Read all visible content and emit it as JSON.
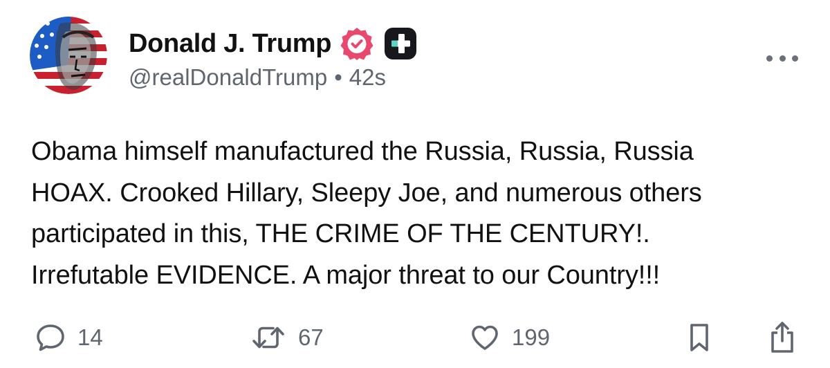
{
  "author": {
    "display_name": "Donald J. Trump",
    "handle": "@realDonaldTrump",
    "separator": "•",
    "timestamp": "42s",
    "verified_color": "#e8476e",
    "avatar_icon": "avatar-flag-portrait",
    "badge_icon": "plus-badge-icon"
  },
  "post": {
    "text_lines": [
      "Obama himself manufactured the Russia, Russia, Russia",
      "HOAX. Crooked Hillary, Sleepy Joe, and numerous others",
      "participated in this, THE CRIME OF THE CENTURY!.",
      "Irrefutable EVIDENCE. A major threat to our Country!!!"
    ]
  },
  "actions": {
    "reply": {
      "icon": "comment-icon",
      "count": "14"
    },
    "retruth": {
      "icon": "repost-icon",
      "count": "67"
    },
    "like": {
      "icon": "heart-icon",
      "count": "199"
    },
    "bookmark": {
      "icon": "bookmark-icon"
    },
    "share": {
      "icon": "share-icon"
    }
  },
  "more_menu": {
    "icon": "more-horizontal-icon"
  },
  "colors": {
    "text": "#111111",
    "muted": "#5f6670",
    "verified": "#e8476e",
    "badge_bg": "#16181c",
    "badge_accent": "#5fd3c4"
  }
}
